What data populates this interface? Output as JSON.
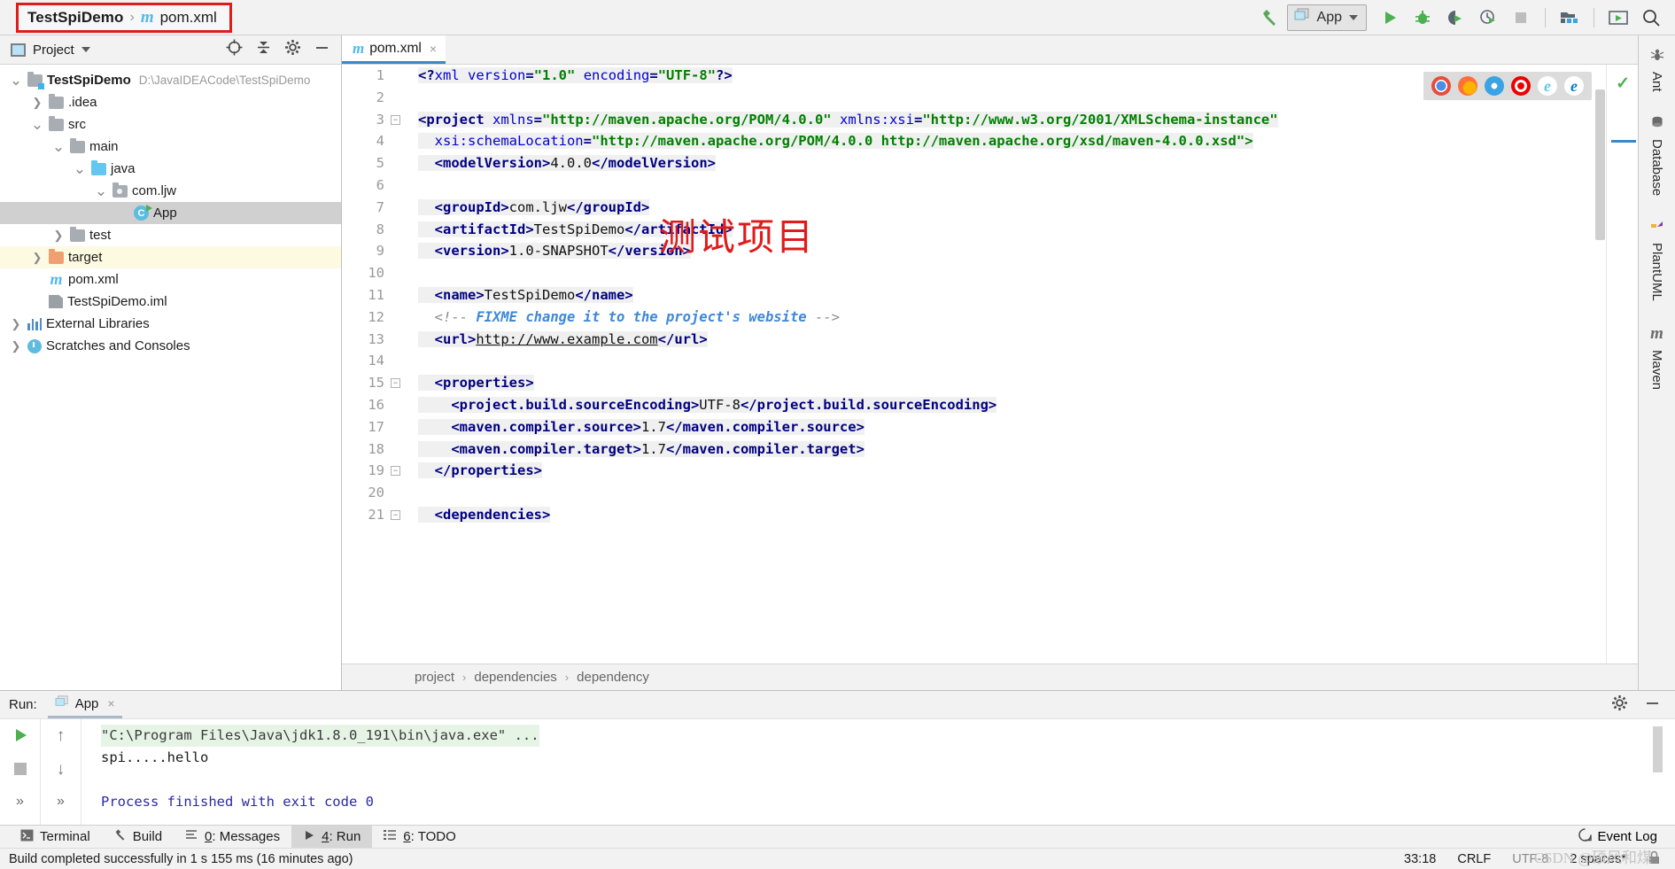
{
  "toolbar": {
    "breadcrumb": {
      "project": "TestSpiDemo",
      "separator": "›",
      "maven_glyph": "m",
      "file": "pom.xml"
    },
    "build_icon": "hammer-icon",
    "run_config": {
      "label": "App",
      "icon": "app-config-icon",
      "chevron": "chevron-down-icon"
    },
    "actions": [
      {
        "name": "run-button",
        "icon": "play-icon"
      },
      {
        "name": "debug-button",
        "icon": "bug-icon"
      },
      {
        "name": "run-coverage-button",
        "icon": "coverage-icon"
      },
      {
        "name": "profiler-button",
        "icon": "profiler-icon"
      },
      {
        "name": "stop-button",
        "icon": "stop-icon"
      },
      {
        "name": "project-structure-button",
        "icon": "project-structure-icon"
      },
      {
        "name": "update-project-button",
        "icon": "terminal-window-icon"
      },
      {
        "name": "search-everywhere-button",
        "icon": "search-icon"
      }
    ]
  },
  "sidebar": {
    "title": "Project",
    "title_chevron": "chevron-down-icon",
    "header_actions": [
      {
        "name": "select-opened-file-button",
        "icon": "target-icon"
      },
      {
        "name": "collapse-all-button",
        "icon": "collapse-all-icon"
      },
      {
        "name": "settings-button",
        "icon": "gear-icon"
      },
      {
        "name": "hide-button",
        "icon": "minimize-icon"
      }
    ],
    "tree": [
      {
        "label": "TestSpiDemo",
        "path": "D:\\JavaIDEACode\\TestSpiDemo",
        "icon": "project-folder-icon",
        "arrow": "⌄",
        "indent": 0,
        "bold": true,
        "state": "normal"
      },
      {
        "label": ".idea",
        "icon": "folder-icon",
        "arrow": "›",
        "indent": 1,
        "bold": false,
        "state": "normal"
      },
      {
        "label": "src",
        "icon": "folder-icon",
        "arrow": "⌄",
        "indent": 1,
        "bold": false,
        "state": "normal"
      },
      {
        "label": "main",
        "icon": "folder-icon",
        "arrow": "⌄",
        "indent": 2,
        "bold": false,
        "state": "normal"
      },
      {
        "label": "java",
        "icon": "source-folder-icon",
        "arrow": "⌄",
        "indent": 3,
        "bold": false,
        "state": "normal"
      },
      {
        "label": "com.ljw",
        "icon": "package-icon",
        "arrow": "⌄",
        "indent": 4,
        "bold": false,
        "state": "normal"
      },
      {
        "label": "App",
        "icon": "java-class-icon",
        "arrow": "",
        "indent": 5,
        "bold": false,
        "state": "selected"
      },
      {
        "label": "test",
        "icon": "folder-icon",
        "arrow": "›",
        "indent": 2,
        "bold": false,
        "state": "normal"
      },
      {
        "label": "target",
        "icon": "target-folder-icon",
        "arrow": "›",
        "indent": 1,
        "bold": false,
        "state": "highlighted"
      },
      {
        "label": "pom.xml",
        "icon": "maven-file-icon",
        "arrow": "",
        "indent": 1,
        "bold": false,
        "state": "normal"
      },
      {
        "label": "TestSpiDemo.iml",
        "icon": "iml-file-icon",
        "arrow": "",
        "indent": 1,
        "bold": false,
        "state": "normal"
      },
      {
        "label": "External Libraries",
        "icon": "libraries-icon",
        "arrow": "›",
        "indent": 0,
        "bold": false,
        "state": "normal"
      },
      {
        "label": "Scratches and Consoles",
        "icon": "scratches-icon",
        "arrow": "›",
        "indent": 0,
        "bold": false,
        "state": "normal"
      }
    ]
  },
  "editor": {
    "tab": {
      "label": "pom.xml",
      "icon": "maven-file-icon",
      "close": "×"
    },
    "line_numbers": [
      "1",
      "2",
      "3",
      "4",
      "5",
      "6",
      "7",
      "8",
      "9",
      "10",
      "11",
      "12",
      "13",
      "14",
      "15",
      "16",
      "17",
      "18",
      "19",
      "20",
      "21"
    ],
    "lines": [
      {
        "n": 1,
        "highlight": true,
        "tokens": [
          {
            "t": "pi",
            "v": "<?"
          },
          {
            "t": "attr",
            "v": "xml"
          },
          {
            "t": "txt",
            "v": " "
          },
          {
            "t": "attr",
            "v": "version"
          },
          {
            "t": "pi",
            "v": "="
          },
          {
            "t": "val",
            "v": "\"1.0\""
          },
          {
            "t": "txt",
            "v": " "
          },
          {
            "t": "attr",
            "v": "encoding"
          },
          {
            "t": "pi",
            "v": "="
          },
          {
            "t": "val",
            "v": "\"UTF-8\""
          },
          {
            "t": "pi",
            "v": "?>"
          }
        ]
      },
      {
        "n": 2,
        "highlight": false,
        "tokens": []
      },
      {
        "n": 3,
        "highlight": true,
        "fold": "minus",
        "tokens": [
          {
            "t": "tag",
            "v": "<project "
          },
          {
            "t": "attr",
            "v": "xmlns"
          },
          {
            "t": "tag",
            "v": "="
          },
          {
            "t": "val",
            "v": "\"http://maven.apache.org/POM/4.0.0\""
          },
          {
            "t": "txt",
            "v": " "
          },
          {
            "t": "attr",
            "v": "xmlns:xsi"
          },
          {
            "t": "tag",
            "v": "="
          },
          {
            "t": "val",
            "v": "\"http://www.w3.org/2001/XMLSchema-instance\""
          }
        ]
      },
      {
        "n": 4,
        "highlight": true,
        "tokens": [
          {
            "t": "txt",
            "v": "  "
          },
          {
            "t": "attr",
            "v": "xsi:schemaLocation"
          },
          {
            "t": "tag",
            "v": "="
          },
          {
            "t": "val",
            "v": "\"http://maven.apache.org/POM/4.0.0 http://maven.apache.org/xsd/maven-4.0.0.xsd\">"
          }
        ]
      },
      {
        "n": 5,
        "highlight": true,
        "tokens": [
          {
            "t": "txt",
            "v": "  "
          },
          {
            "t": "tag",
            "v": "<modelVersion>"
          },
          {
            "t": "txt",
            "v": "4.0.0"
          },
          {
            "t": "tag",
            "v": "</modelVersion>"
          }
        ]
      },
      {
        "n": 6,
        "highlight": false,
        "tokens": []
      },
      {
        "n": 7,
        "highlight": true,
        "tokens": [
          {
            "t": "txt",
            "v": "  "
          },
          {
            "t": "tag",
            "v": "<groupId>"
          },
          {
            "t": "txt",
            "v": "com.ljw"
          },
          {
            "t": "tag",
            "v": "</groupId>"
          }
        ]
      },
      {
        "n": 8,
        "highlight": true,
        "tokens": [
          {
            "t": "txt",
            "v": "  "
          },
          {
            "t": "tag",
            "v": "<artifactId>"
          },
          {
            "t": "txt",
            "v": "TestSpiDemo"
          },
          {
            "t": "tag",
            "v": "</artifactId>"
          }
        ]
      },
      {
        "n": 9,
        "highlight": true,
        "tokens": [
          {
            "t": "txt",
            "v": "  "
          },
          {
            "t": "tag",
            "v": "<version>"
          },
          {
            "t": "txt",
            "v": "1.0-SNAPSHOT"
          },
          {
            "t": "tag",
            "v": "</version>"
          }
        ]
      },
      {
        "n": 10,
        "highlight": false,
        "tokens": []
      },
      {
        "n": 11,
        "highlight": true,
        "tokens": [
          {
            "t": "txt",
            "v": "  "
          },
          {
            "t": "tag",
            "v": "<name>"
          },
          {
            "t": "txt",
            "v": "TestSpiDemo"
          },
          {
            "t": "tag",
            "v": "</name>"
          }
        ]
      },
      {
        "n": 12,
        "highlight": false,
        "tokens": [
          {
            "t": "txt",
            "v": "  "
          },
          {
            "t": "cmtd",
            "v": "<!-- "
          },
          {
            "t": "cmt",
            "v": "FIXME change it to the project's website"
          },
          {
            "t": "cmtd",
            "v": " -->"
          }
        ]
      },
      {
        "n": 13,
        "highlight": true,
        "tokens": [
          {
            "t": "txt",
            "v": "  "
          },
          {
            "t": "tag",
            "v": "<url>"
          },
          {
            "t": "lnk",
            "v": "http://www.example.com"
          },
          {
            "t": "tag",
            "v": "</url>"
          }
        ]
      },
      {
        "n": 14,
        "highlight": false,
        "tokens": []
      },
      {
        "n": 15,
        "highlight": true,
        "fold": "minus",
        "tokens": [
          {
            "t": "txt",
            "v": "  "
          },
          {
            "t": "tag",
            "v": "<properties>"
          }
        ]
      },
      {
        "n": 16,
        "highlight": true,
        "tokens": [
          {
            "t": "txt",
            "v": "    "
          },
          {
            "t": "tag",
            "v": "<project.build.sourceEncoding>"
          },
          {
            "t": "txt",
            "v": "UTF-8"
          },
          {
            "t": "tag",
            "v": "</project.build.sourceEncoding>"
          }
        ]
      },
      {
        "n": 17,
        "highlight": true,
        "tokens": [
          {
            "t": "txt",
            "v": "    "
          },
          {
            "t": "tag",
            "v": "<maven.compiler.source>"
          },
          {
            "t": "txt",
            "v": "1.7"
          },
          {
            "t": "tag",
            "v": "</maven.compiler.source>"
          }
        ]
      },
      {
        "n": 18,
        "highlight": true,
        "tokens": [
          {
            "t": "txt",
            "v": "    "
          },
          {
            "t": "tag",
            "v": "<maven.compiler.target>"
          },
          {
            "t": "txt",
            "v": "1.7"
          },
          {
            "t": "tag",
            "v": "</maven.compiler.target>"
          }
        ]
      },
      {
        "n": 19,
        "highlight": true,
        "fold": "plus",
        "tokens": [
          {
            "t": "txt",
            "v": "  "
          },
          {
            "t": "tag",
            "v": "</properties>"
          }
        ]
      },
      {
        "n": 20,
        "highlight": false,
        "tokens": []
      },
      {
        "n": 21,
        "highlight": true,
        "fold": "minus",
        "tokens": [
          {
            "t": "txt",
            "v": "  "
          },
          {
            "t": "tag",
            "v": "<dependencies>"
          }
        ]
      }
    ],
    "browser_popup": [
      {
        "name": "chrome-icon",
        "color": "#4caf50"
      },
      {
        "name": "firefox-icon",
        "color": "#ff7139"
      },
      {
        "name": "safari-icon",
        "color": "#3aa3e3"
      },
      {
        "name": "opera-icon",
        "color": "#ee0000"
      },
      {
        "name": "ie-icon",
        "color": "#5bc8f5"
      },
      {
        "name": "edge-icon",
        "color": "#0d7ec9"
      }
    ],
    "breadcrumb_bottom": [
      "project",
      "dependencies",
      "dependency"
    ],
    "breadcrumb_sep": "›",
    "overlay_text": "测试项目",
    "overlay_color": "#e01b1b"
  },
  "right_strip": [
    {
      "label": "Ant",
      "icon": "ant-icon"
    },
    {
      "label": "Database",
      "icon": "database-icon"
    },
    {
      "label": "PlantUML",
      "icon": "plantuml-icon"
    },
    {
      "label": "Maven",
      "icon": "maven-icon"
    }
  ],
  "run_panel": {
    "label": "Run:",
    "tab": {
      "label": "App",
      "icon": "app-config-icon",
      "close": "×"
    },
    "header_actions": [
      {
        "name": "run-settings-button",
        "icon": "gear-icon"
      },
      {
        "name": "hide-run-panel-button",
        "icon": "minimize-icon"
      }
    ],
    "side_actions": [
      {
        "name": "rerun-button",
        "icon": "play-icon"
      },
      {
        "name": "stop-process-button",
        "icon": "stop-icon"
      },
      {
        "name": "more-actions-button",
        "icon": "chevron-double-right-icon"
      }
    ],
    "side_actions2": [
      {
        "name": "previous-occurrence-button",
        "icon": "arrow-up-icon"
      },
      {
        "name": "next-occurrence-button",
        "icon": "arrow-down-icon"
      },
      {
        "name": "more-console-actions-button",
        "icon": "chevron-double-right-icon"
      }
    ],
    "console": [
      {
        "text": "\"C:\\Program Files\\Java\\jdk1.8.0_191\\bin\\java.exe\" ...",
        "style": "green"
      },
      {
        "text": "spi.....hello",
        "style": "black"
      },
      {
        "text": "",
        "style": "black"
      },
      {
        "text": "Process finished with exit code 0",
        "style": "blue"
      }
    ]
  },
  "tool_window_bar": {
    "items": [
      {
        "label": "Terminal",
        "icon": "terminal-icon",
        "mnemonic": "",
        "active": false
      },
      {
        "label": "Build",
        "icon": "hammer-icon",
        "mnemonic": "",
        "active": false
      },
      {
        "label": ": Messages",
        "icon": "messages-icon",
        "mnemonic": "0",
        "active": false
      },
      {
        "label": ": Run",
        "icon": "play-icon",
        "mnemonic": "4",
        "active": true
      },
      {
        "label": ": TODO",
        "icon": "todo-icon",
        "mnemonic": "6",
        "active": false
      }
    ],
    "event_log": {
      "label": "Event Log",
      "icon": "event-log-icon"
    }
  },
  "status_bar": {
    "message": "Build completed successfully in 1 s 155 ms (16 minutes ago)",
    "caret": "33:18",
    "line_separator": "CRLF",
    "encoding": "UTF-8",
    "indent": "2 spaces*",
    "lock_icon": "lock-icon",
    "watermark": "CSDN @硕风和煤"
  }
}
